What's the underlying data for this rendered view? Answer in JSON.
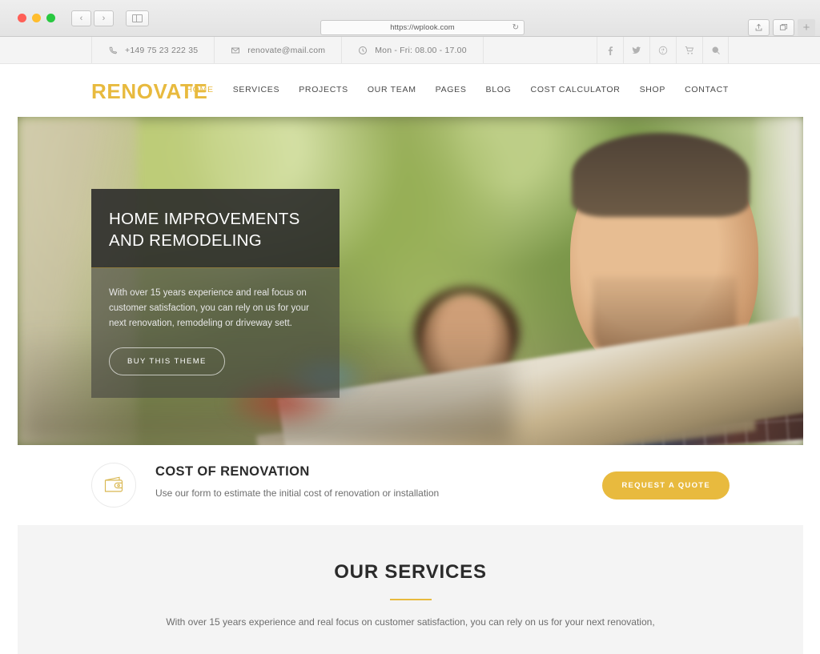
{
  "browser": {
    "url": "https://wplook.com",
    "reload_icon": "reload-icon",
    "back_icon": "‹",
    "forward_icon": "›",
    "sidebar_icon": "sidebar-icon",
    "share_icon": "share-icon",
    "tabs_icon": "tabs-icon",
    "new_tab_icon": "+"
  },
  "topbar": {
    "phone": "+149 75 23 222 35",
    "email": "renovate@mail.com",
    "hours": "Mon - Fri: 08.00 - 17.00",
    "social": [
      {
        "name": "facebook",
        "glyph": "f"
      },
      {
        "name": "twitter",
        "glyph": "t"
      },
      {
        "name": "pinterest",
        "glyph": "p"
      },
      {
        "name": "cart",
        "glyph": "c"
      },
      {
        "name": "search",
        "glyph": "s"
      }
    ]
  },
  "header": {
    "logo": "RENOVATE",
    "nav": [
      {
        "label": "HOME",
        "active": true
      },
      {
        "label": "SERVICES",
        "active": false
      },
      {
        "label": "PROJECTS",
        "active": false
      },
      {
        "label": "OUR TEAM",
        "active": false
      },
      {
        "label": "PAGES",
        "active": false
      },
      {
        "label": "BLOG",
        "active": false
      },
      {
        "label": "COST CALCULATOR",
        "active": false
      },
      {
        "label": "SHOP",
        "active": false
      },
      {
        "label": "CONTACT",
        "active": false
      }
    ]
  },
  "hero": {
    "title_line1": "HOME IMPROVEMENTS",
    "title_line2": "AND REMODELING",
    "description": "With over 15 years experience and real focus on customer satisfaction, you can rely on us for your next renovation, remodeling or driveway sett.",
    "button": "BUY THIS THEME"
  },
  "cost": {
    "icon": "wallet-icon",
    "title": "COST OF RENOVATION",
    "subtitle": "Use our form to estimate the initial cost of renovation or installation",
    "button": "REQUEST A QUOTE"
  },
  "services": {
    "title": "OUR SERVICES",
    "description": "With over 15 years experience and real focus on customer satisfaction, you can rely on us for your next renovation,"
  },
  "colors": {
    "accent": "#e8ba3e",
    "dark": "#2b2b2b",
    "section_bg": "#f4f4f4"
  }
}
